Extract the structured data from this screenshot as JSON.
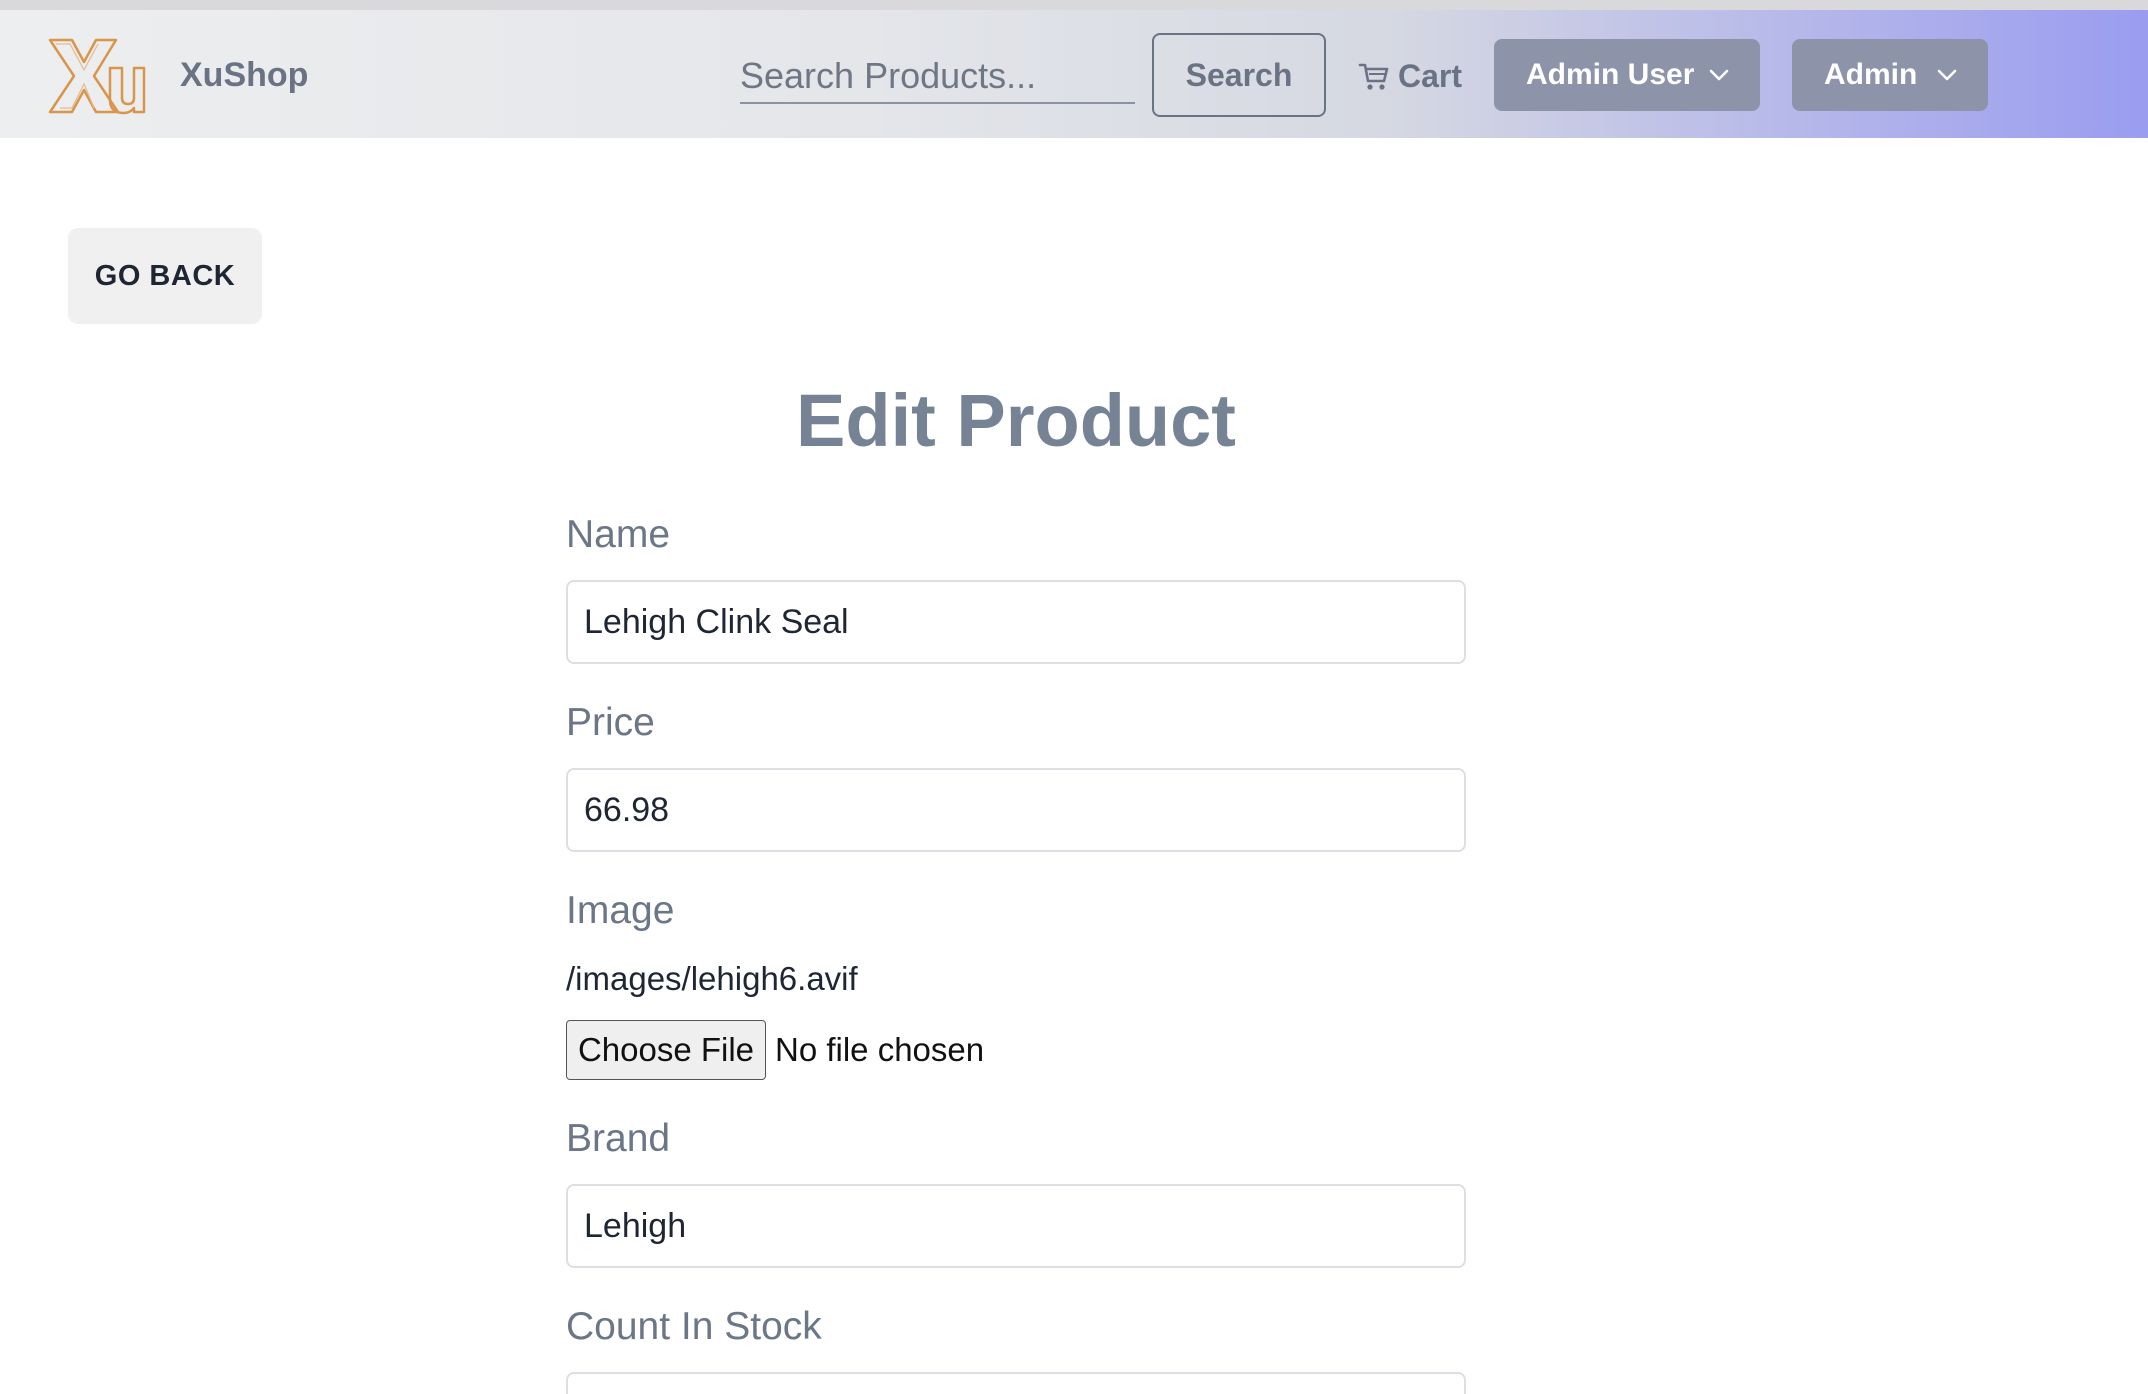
{
  "navbar": {
    "brand_name": "XuShop",
    "search_placeholder": "Search Products...",
    "search_button": "Search",
    "cart_label": "Cart",
    "user_menu_label": "Admin User",
    "admin_menu_label": "Admin"
  },
  "page": {
    "go_back": "GO BACK",
    "title": "Edit Product"
  },
  "form": {
    "name_label": "Name",
    "name_value": "Lehigh Clink Seal",
    "price_label": "Price",
    "price_value": "66.98",
    "image_label": "Image",
    "image_path": "/images/lehigh6.avif",
    "choose_file_label": "Choose File",
    "file_status": "No file chosen",
    "brand_label": "Brand",
    "brand_value": "Lehigh",
    "count_label": "Count In Stock"
  },
  "icons": {
    "logo": "xu-logo",
    "cart": "cart-icon",
    "chevron": "chevron-down-icon"
  },
  "colors": {
    "nav_button_bg": "#8d93a8",
    "title_color": "#768395",
    "logo_color": "#d9954a"
  }
}
